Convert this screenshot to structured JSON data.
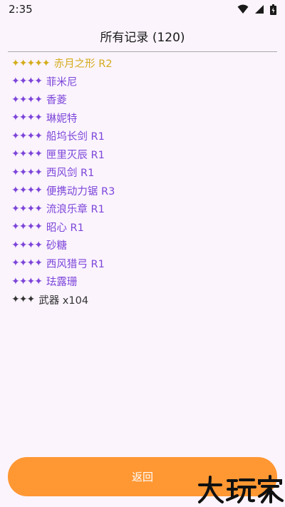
{
  "status_bar": {
    "time": "2:35"
  },
  "header": {
    "title": "所有记录 (120)"
  },
  "records": [
    {
      "stars": "✦✦✦✦✦",
      "rarity": 5,
      "label": "赤月之形 R2"
    },
    {
      "stars": "✦✦✦✦",
      "rarity": 4,
      "label": "菲米尼"
    },
    {
      "stars": "✦✦✦✦",
      "rarity": 4,
      "label": "香菱"
    },
    {
      "stars": "✦✦✦✦",
      "rarity": 4,
      "label": "琳妮特"
    },
    {
      "stars": "✦✦✦✦",
      "rarity": 4,
      "label": "船坞长剑 R1"
    },
    {
      "stars": "✦✦✦✦",
      "rarity": 4,
      "label": "匣里灭辰 R1"
    },
    {
      "stars": "✦✦✦✦",
      "rarity": 4,
      "label": "西风剑 R1"
    },
    {
      "stars": "✦✦✦✦",
      "rarity": 4,
      "label": "便携动力锯 R3"
    },
    {
      "stars": "✦✦✦✦",
      "rarity": 4,
      "label": "流浪乐章 R1"
    },
    {
      "stars": "✦✦✦✦",
      "rarity": 4,
      "label": "昭心 R1"
    },
    {
      "stars": "✦✦✦✦",
      "rarity": 4,
      "label": "砂糖"
    },
    {
      "stars": "✦✦✦✦",
      "rarity": 4,
      "label": "西风猎弓 R1"
    },
    {
      "stars": "✦✦✦✦",
      "rarity": 4,
      "label": "珐露珊"
    },
    {
      "stars": "✦✦✦",
      "rarity": 3,
      "label": "武器 x104"
    }
  ],
  "footer": {
    "back_label": "返回"
  },
  "watermark": {
    "text": "大玩家"
  },
  "colors": {
    "five_star": "#d4ac1b",
    "four_star": "#7d45d9",
    "three_star": "#333333",
    "button": "#ff9733",
    "background": "#fbf4fd"
  }
}
